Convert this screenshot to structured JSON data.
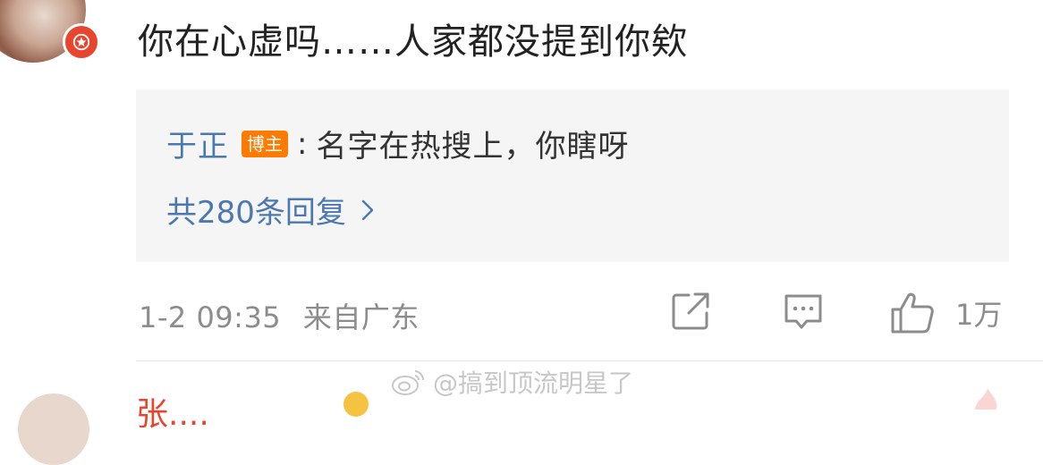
{
  "comment": {
    "text": "你在心虚吗……人家都没提到你欸"
  },
  "reply": {
    "author": "于正",
    "badge": "博主",
    "colon": ":",
    "text": "名字在热搜上，你瞎呀",
    "count_label": "共280条回复"
  },
  "meta": {
    "time": "1-2 09:35",
    "location": "来自广东",
    "like_count": "1万"
  },
  "next_comment": {
    "name": "张...."
  },
  "watermark": {
    "text": "@搞到顶流明星了"
  },
  "colors": {
    "link_blue": "#4b78b1",
    "badge_orange": "#ff7a00",
    "reply_bg": "#f5f5f5",
    "meta_gray": "#8c8c8c"
  }
}
